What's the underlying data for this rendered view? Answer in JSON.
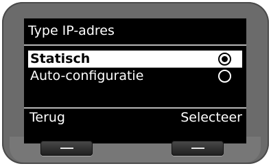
{
  "screen": {
    "title": "Type IP-adres",
    "options": [
      {
        "label": "Statisch",
        "selected": true
      },
      {
        "label": "Auto-configuratie",
        "selected": false
      }
    ],
    "softkeys": {
      "left": "Terug",
      "right": "Selecteer"
    }
  },
  "colors": {
    "body": "#6b6b6b",
    "screen": "#000000",
    "highlight": "#ffffff"
  }
}
